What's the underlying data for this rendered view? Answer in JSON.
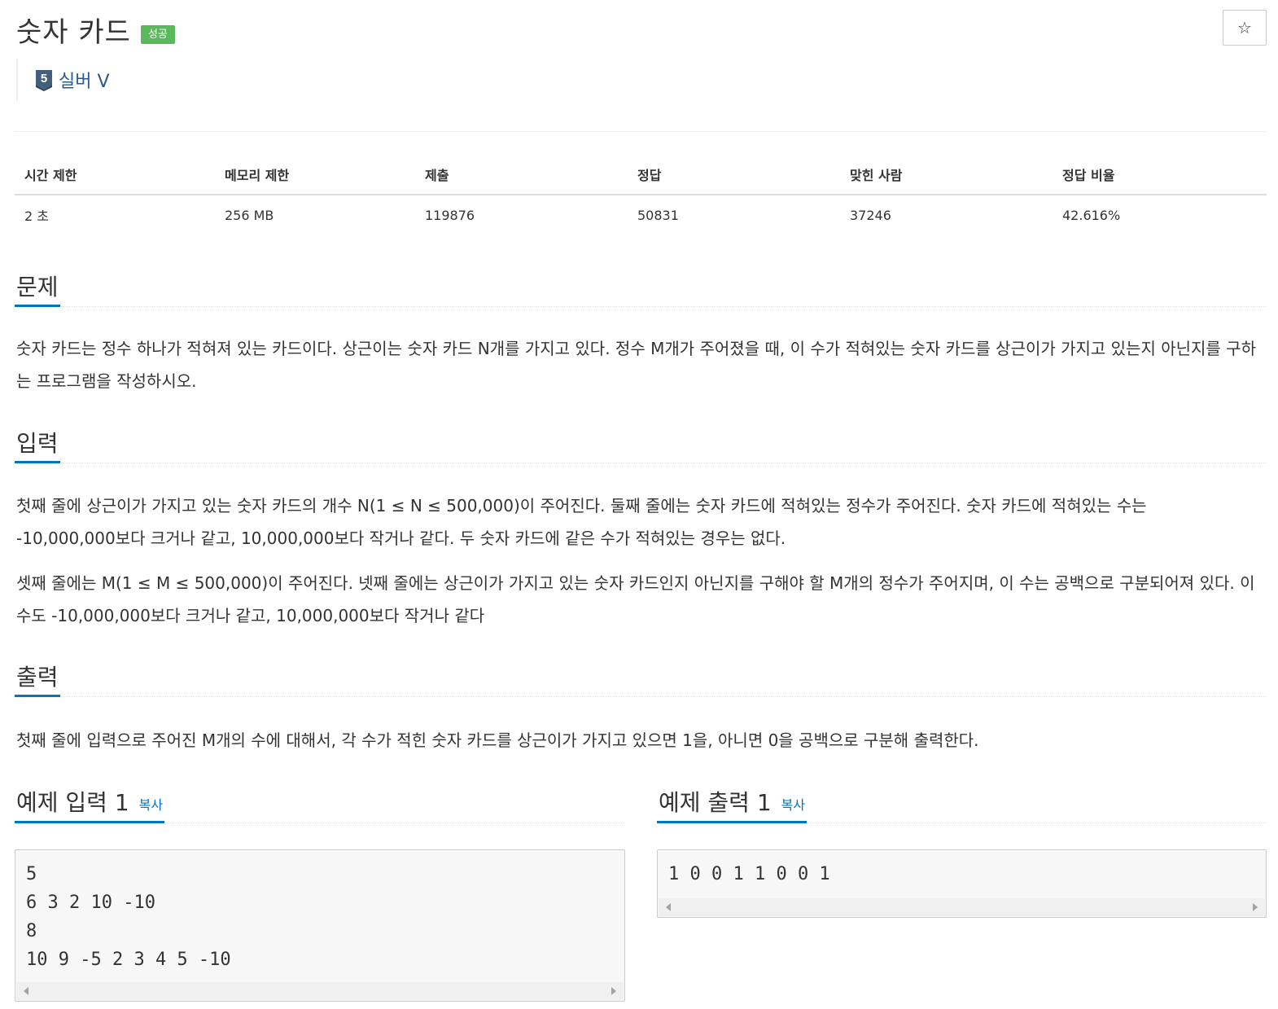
{
  "problem": {
    "title": "숫자 카드",
    "status_badge": "성공",
    "star_icon": "☆",
    "tier": {
      "number": "5",
      "label": "실버 V",
      "color": "#435f7a"
    }
  },
  "info_table": {
    "headers": [
      "시간 제한",
      "메모리 제한",
      "제출",
      "정답",
      "맞힌 사람",
      "정답 비율"
    ],
    "row": [
      "2 초",
      "256 MB",
      "119876",
      "50831",
      "37246",
      "42.616%"
    ]
  },
  "sections": {
    "description": {
      "heading": "문제",
      "text": "숫자 카드는 정수 하나가 적혀져 있는 카드이다. 상근이는 숫자 카드 N개를 가지고 있다. 정수 M개가 주어졌을 때, 이 수가 적혀있는 숫자 카드를 상근이가 가지고 있는지 아닌지를 구하는 프로그램을 작성하시오."
    },
    "input": {
      "heading": "입력",
      "paragraph_1": "첫째 줄에 상근이가 가지고 있는 숫자 카드의 개수 N(1 ≤ N ≤ 500,000)이 주어진다. 둘째 줄에는 숫자 카드에 적혀있는 정수가 주어진다. 숫자 카드에 적혀있는 수는 -10,000,000보다 크거나 같고, 10,000,000보다 작거나 같다. 두 숫자 카드에 같은 수가 적혀있는 경우는 없다.",
      "paragraph_2": "셋째 줄에는 M(1 ≤ M ≤ 500,000)이 주어진다. 넷째 줄에는 상근이가 가지고 있는 숫자 카드인지 아닌지를 구해야 할 M개의 정수가 주어지며, 이 수는 공백으로 구분되어져 있다. 이 수도 -10,000,000보다 크거나 같고, 10,000,000보다 작거나 같다"
    },
    "output": {
      "heading": "출력",
      "text": "첫째 줄에 입력으로 주어진 M개의 수에 대해서, 각 수가 적힌 숫자 카드를 상근이가 가지고 있으면 1을, 아니면 0을 공백으로 구분해 출력한다."
    }
  },
  "samples": {
    "input": {
      "heading": "예제 입력 1",
      "copy_label": "복사",
      "content": "5\n6 3 2 10 -10\n8\n10 9 -5 2 3 4 5 -10"
    },
    "output": {
      "heading": "예제 출력 1",
      "copy_label": "복사",
      "content": "1 0 0 1 1 0 0 1"
    }
  },
  "colors": {
    "accent": "#0076c0",
    "success": "#5cb85c",
    "tier": "#435f7a"
  }
}
